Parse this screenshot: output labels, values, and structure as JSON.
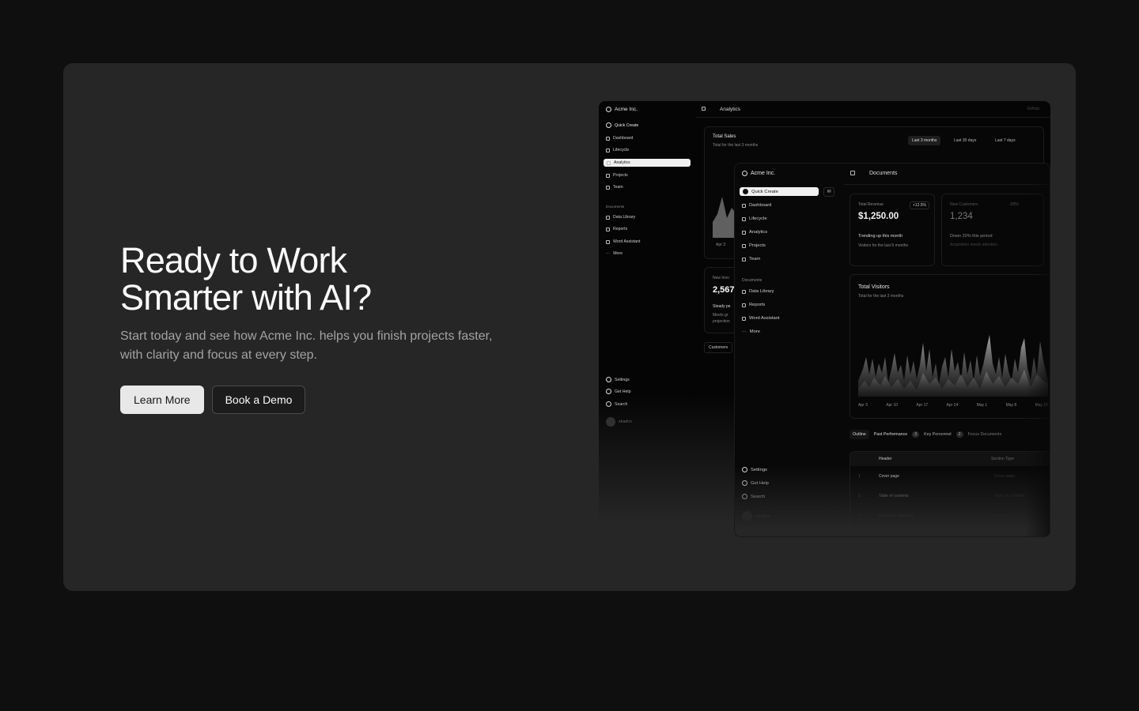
{
  "hero": {
    "title_line1": "Ready to Work",
    "title_line2": "Smarter with AI?",
    "subtitle": "Start today and see how Acme Inc. helps you finish projects faster, with clarity and focus at every step.",
    "learn_more": "Learn More",
    "book_demo": "Book a Demo"
  },
  "back_window": {
    "brand": "Acme Inc.",
    "page": "Analytics",
    "top_right": "GitHub",
    "quick_create": "Quick Create",
    "nav": [
      "Dashboard",
      "Lifecycle",
      "Analytics",
      "Projects",
      "Team"
    ],
    "documents_label": "Documents",
    "doc_nav": [
      "Data Library",
      "Reports",
      "Word Assistant",
      "More"
    ],
    "footer_nav": [
      "Settings",
      "Get Help",
      "Search"
    ],
    "user": "shadcn",
    "total_sales": "Total Sales",
    "total_sales_sub": "Total for the last 3 months",
    "ranges": [
      "Last 3 months",
      "Last 30 days",
      "Last 7 days"
    ],
    "x_first": "Apr 3",
    "new_label": "New Invo",
    "new_value": "2,567",
    "steady": "Steady pe",
    "meets": "Meets gr",
    "projection": "projection",
    "customers": "Customers"
  },
  "front_window": {
    "brand": "Acme Inc.",
    "page": "Documents",
    "quick_create": "Quick Create",
    "nav": [
      "Dashboard",
      "Lifecycle",
      "Analytics",
      "Projects",
      "Team"
    ],
    "documents_label": "Documents",
    "doc_nav": [
      "Data Library",
      "Reports",
      "Word Assistant",
      "More"
    ],
    "footer_nav": [
      "Settings",
      "Get Help",
      "Search"
    ],
    "user": "shadcn",
    "revenue_label": "Total Revenue",
    "revenue_badge": "+12.5%",
    "revenue_value": "$1,250.00",
    "revenue_trend": "Trending up this month",
    "revenue_note": "Visitors for the last 6 months",
    "customers_label": "New Customers",
    "customers_badge": "-20%",
    "customers_value": "1,234",
    "customers_trend": "Down 20% this period",
    "customers_note": "Acquisition needs attention",
    "visitors_title": "Total Visitors",
    "visitors_sub": "Total for the last 3 months",
    "x_ticks": [
      "Apr 3",
      "Apr 10",
      "Apr 17",
      "Apr 24",
      "May 1",
      "May 8",
      "May 15"
    ],
    "tabs": [
      "Outline",
      "Past Performance",
      "Key Personnel",
      "Focus Documents"
    ],
    "tab_badges": [
      "3",
      "2"
    ],
    "table_headers": [
      "Header",
      "Section Type"
    ],
    "table_rows": [
      {
        "num": "1",
        "header": "Cover page",
        "type": "Cover page"
      },
      {
        "num": "2",
        "header": "Table of contents",
        "type": "Table of contents"
      },
      {
        "num": "3",
        "header": "Executive summary",
        "type": "Narrative"
      }
    ]
  }
}
